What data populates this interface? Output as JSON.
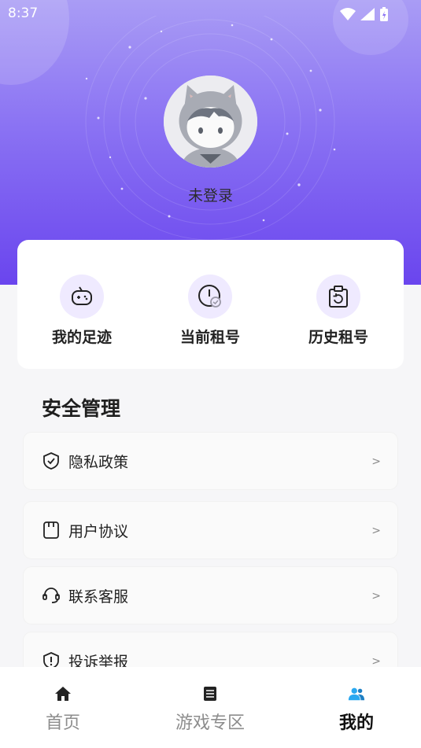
{
  "status_bar": {
    "time": "8:37"
  },
  "profile": {
    "login_status": "未登录"
  },
  "quick_actions": [
    {
      "label": "我的足迹",
      "icon": "gamepad-icon"
    },
    {
      "label": "当前租号",
      "icon": "clock-check-icon"
    },
    {
      "label": "历史租号",
      "icon": "clipboard-history-icon"
    }
  ],
  "security": {
    "title": "安全管理",
    "items": [
      {
        "label": "隐私政策",
        "icon": "shield-check-icon",
        "arrow": ">"
      },
      {
        "label": "用户协议",
        "icon": "document-icon",
        "arrow": ">"
      },
      {
        "label": "联系客服",
        "icon": "headset-icon",
        "arrow": ">"
      },
      {
        "label": "投诉举报",
        "icon": "alert-shield-icon",
        "arrow": ">"
      }
    ]
  },
  "tabbar": {
    "items": [
      {
        "label": "首页",
        "icon": "home-icon"
      },
      {
        "label": "游戏专区",
        "icon": "news-icon"
      },
      {
        "label": "我的",
        "icon": "user-group-icon"
      }
    ],
    "active_index": 2
  },
  "colors": {
    "accent": "#6a45ee",
    "header_top": "#a99cf5",
    "icon_bg": "#efeaff",
    "tab_active_icon": "#2aa8f0"
  }
}
